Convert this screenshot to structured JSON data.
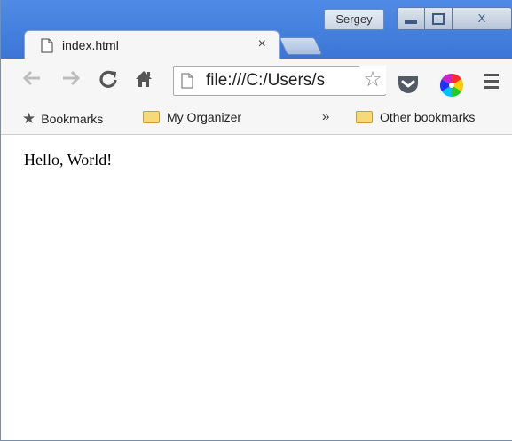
{
  "window": {
    "profile_name": "Sergey",
    "close_label": "X"
  },
  "tab": {
    "title": "index.html",
    "close_glyph": "×"
  },
  "toolbar": {
    "address": "file:///C:/Users/s",
    "icons": [
      "back-arrow-icon",
      "forward-arrow-icon",
      "reload-icon",
      "home-icon",
      "page-icon",
      "star-icon",
      "pocket-icon",
      "color-wheel-icon",
      "menu-icon"
    ]
  },
  "bookmarks_bar": {
    "bookmarks_label": "Bookmarks",
    "organizer_label": "My Organizer",
    "overflow_label": "»",
    "other_label": "Other bookmarks"
  },
  "page": {
    "text": "Hello, World!"
  },
  "colors": {
    "titlebar": "#3b76d6",
    "toolbar_bg": "#f6f6f6",
    "folder": "#f7d97a",
    "pocket": "#e8414a"
  }
}
